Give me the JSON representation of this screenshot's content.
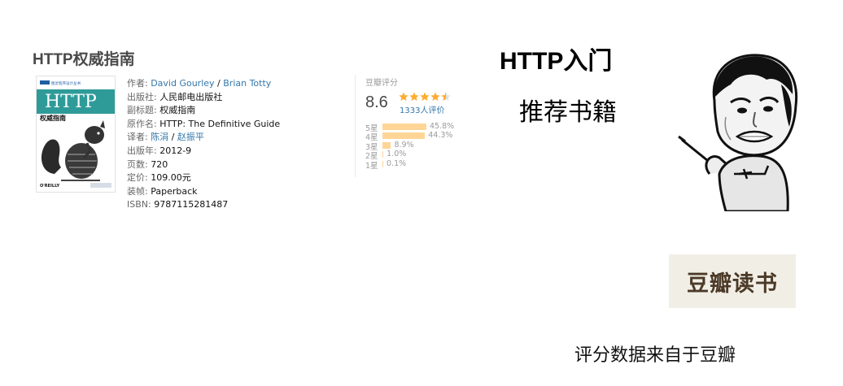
{
  "book": {
    "title": "HTTP权威指南",
    "cover": {
      "series": "图灵程序设计丛书",
      "title_en": "HTTP",
      "subtitle_cn": "权威指南",
      "publisher_mark": "O'REILLY"
    },
    "info": [
      {
        "label": "作者:",
        "values": [
          "David Gourley",
          "Brian Totty"
        ],
        "link": true
      },
      {
        "label": "出版社:",
        "value": "人民邮电出版社"
      },
      {
        "label": "副标题:",
        "value": "权威指南"
      },
      {
        "label": "原作名:",
        "value": "HTTP: The Definitive Guide"
      },
      {
        "label": "译者:",
        "values": [
          "陈涓",
          "赵振平"
        ],
        "link": true
      },
      {
        "label": "出版年:",
        "value": "2012-9"
      },
      {
        "label": "页数:",
        "value": "720"
      },
      {
        "label": "定价:",
        "value": "109.00元"
      },
      {
        "label": "装帧:",
        "value": "Paperback"
      },
      {
        "label": "ISBN:",
        "value": "9787115281487"
      }
    ]
  },
  "rating": {
    "label": "豆瓣评分",
    "score": "8.6",
    "stars": 4.5,
    "people": "1333人评价",
    "distribution": [
      {
        "label": "5星",
        "percent": 45.8,
        "text": "45.8%"
      },
      {
        "label": "4星",
        "percent": 44.3,
        "text": "44.3%"
      },
      {
        "label": "3星",
        "percent": 8.9,
        "text": "8.9%"
      },
      {
        "label": "2星",
        "percent": 1.0,
        "text": "1.0%"
      },
      {
        "label": "1星",
        "percent": 0.1,
        "text": "0.1%"
      }
    ],
    "star_color": "#ffac2d",
    "bar_color": "#ffd596"
  },
  "captions": {
    "line1": "HTTP入门",
    "line2": "推荐书籍"
  },
  "logo": {
    "text": "豆瓣读书"
  },
  "footer": {
    "text": "评分数据来自于豆瓣"
  }
}
